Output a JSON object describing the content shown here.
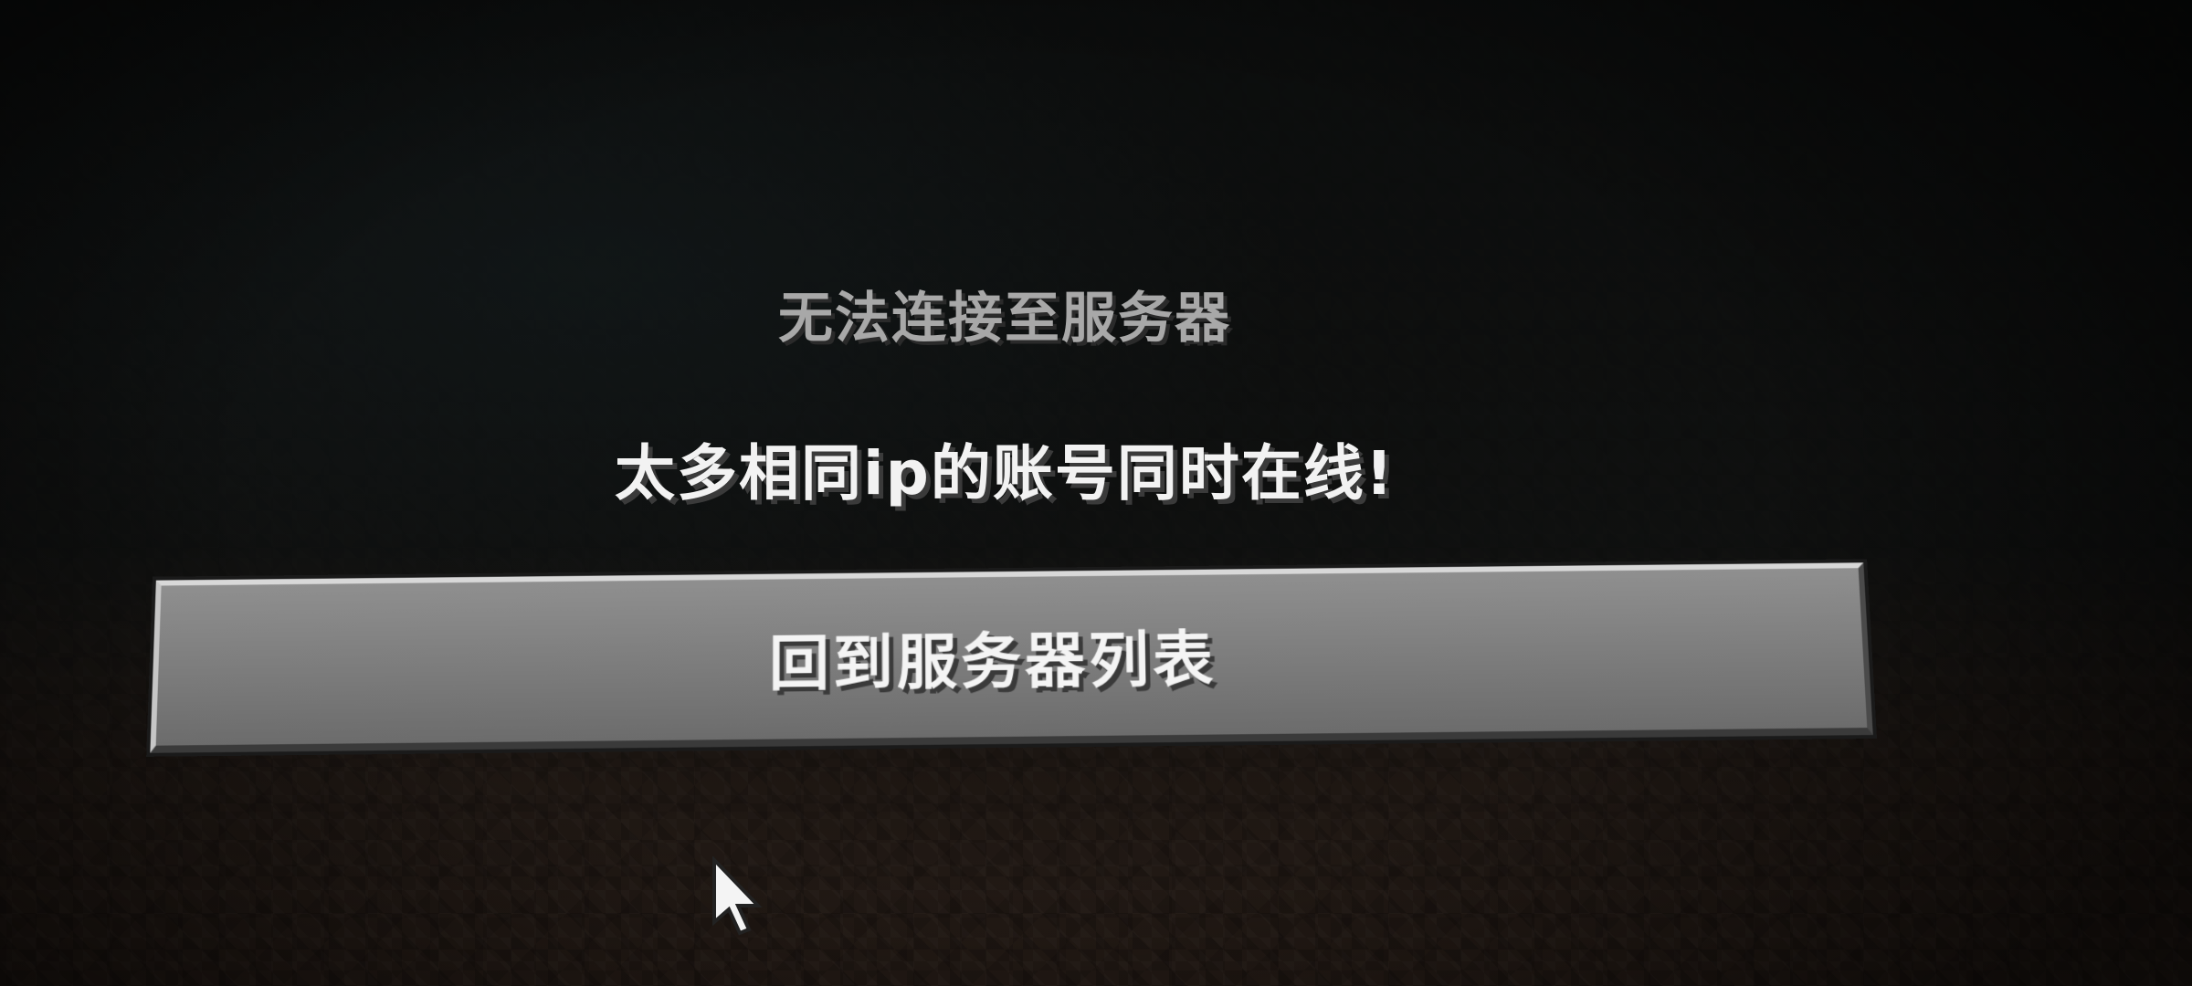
{
  "dialog": {
    "title": "无法连接至服务器",
    "reason": "太多相同ip的账号同时在线!",
    "back_button_label": "回到服务器列表"
  },
  "icons": {
    "cursor": "mouse-pointer-icon"
  },
  "colors": {
    "title_text": "#a8a8a8",
    "reason_text": "#f2f2f2",
    "button_face": "#7a7a7a",
    "background": "#3a2c22"
  }
}
